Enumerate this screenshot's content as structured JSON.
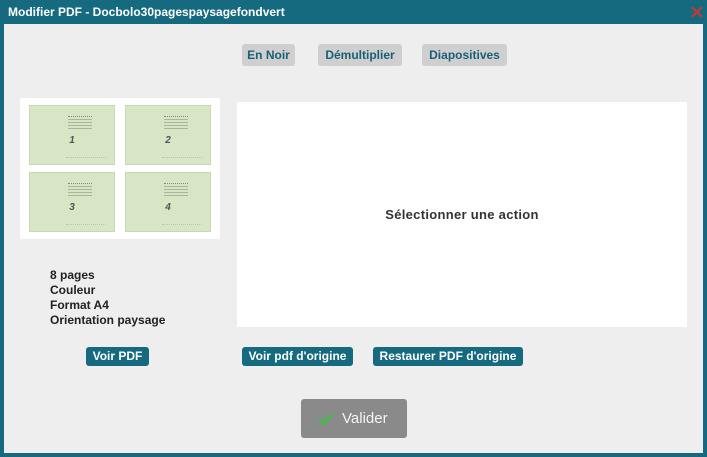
{
  "window": {
    "title": "Modifier PDF - Docbolo30pagespaysagefondvert"
  },
  "toolbar": {
    "buttons": [
      "En Noir",
      "Démultiplier",
      "Diapositives"
    ]
  },
  "thumbnails": [
    "1",
    "2",
    "3",
    "4"
  ],
  "info": {
    "pages": "8 pages",
    "color": "Couleur",
    "format": "Format A4",
    "orientation": "Orientation paysage"
  },
  "preview": {
    "message": "Sélectionner une action"
  },
  "actions": {
    "view_pdf": "Voir PDF",
    "view_original": "Voir pdf d'origine",
    "restore_original": "Restaurer PDF d'origine"
  },
  "footer": {
    "validate_label": "Valider"
  },
  "colors": {
    "titlebar": "#166a80",
    "accent_button": "#166a80",
    "close_icon": "#d8322b",
    "check_icon": "#3fbf3f"
  },
  "icons": {
    "close": "close-icon",
    "check": "check-icon"
  }
}
